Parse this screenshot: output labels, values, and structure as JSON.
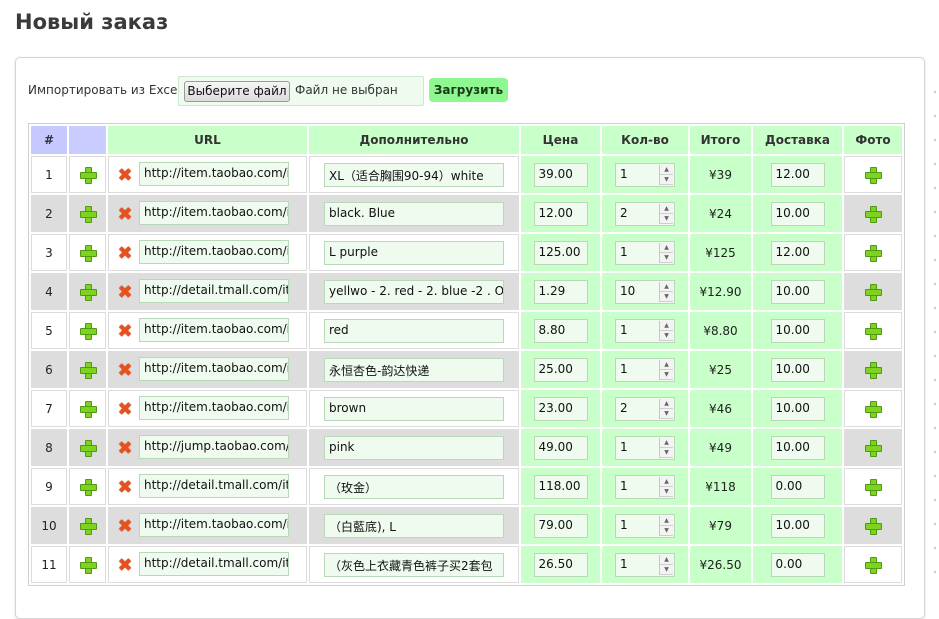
{
  "page": {
    "title": "Новый заказ"
  },
  "import": {
    "label": "Импортировать из Excel:",
    "file_button": "Выберите файл",
    "file_status": "Файл не выбран",
    "upload_button": "Загрузить"
  },
  "table": {
    "headers": {
      "num": "#",
      "url": "URL",
      "extra": "Дополнительно",
      "price": "Цена",
      "qty": "Кол-во",
      "total": "Итого",
      "shipping": "Доставка",
      "photo": "Фото"
    },
    "rows": [
      {
        "num": "1",
        "url": "http://item.taobao.com/item.htm",
        "extra": "XL（适合胸围90-94）white",
        "price": "39.00",
        "qty": "1",
        "total": "¥39",
        "shipping": "12.00"
      },
      {
        "num": "2",
        "url": "http://item.taobao.com/item.htm",
        "extra": "black. Blue",
        "price": "12.00",
        "qty": "2",
        "total": "¥24",
        "shipping": "10.00"
      },
      {
        "num": "3",
        "url": "http://item.taobao.com/item.htm",
        "extra": "L purple",
        "price": "125.00",
        "qty": "1",
        "total": "¥125",
        "shipping": "12.00"
      },
      {
        "num": "4",
        "url": "http://detail.tmall.com/item.htm",
        "extra": "yellwo - 2. red - 2. blue -2 . O",
        "price": "1.29",
        "qty": "10",
        "total": "¥12.90",
        "shipping": "10.00"
      },
      {
        "num": "5",
        "url": "http://item.taobao.com/item.htm",
        "extra": "red",
        "price": "8.80",
        "qty": "1",
        "total": "¥8.80",
        "shipping": "10.00"
      },
      {
        "num": "6",
        "url": "http://item.taobao.com/item.htm",
        "extra": "永恒杏色-韵达快递",
        "price": "25.00",
        "qty": "1",
        "total": "¥25",
        "shipping": "10.00"
      },
      {
        "num": "7",
        "url": "http://item.taobao.com/item.htm",
        "extra": "brown",
        "price": "23.00",
        "qty": "2",
        "total": "¥46",
        "shipping": "10.00"
      },
      {
        "num": "8",
        "url": "http://jump.taobao.com/jump",
        "extra": "pink",
        "price": "49.00",
        "qty": "1",
        "total": "¥49",
        "shipping": "10.00"
      },
      {
        "num": "9",
        "url": "http://detail.tmall.com/item.htm",
        "extra": "（玫金）",
        "price": "118.00",
        "qty": "1",
        "total": "¥118",
        "shipping": "0.00"
      },
      {
        "num": "10",
        "url": "http://item.taobao.com/item.htm",
        "extra": "（白藍底), L",
        "price": "79.00",
        "qty": "1",
        "total": "¥79",
        "shipping": "10.00"
      },
      {
        "num": "11",
        "url": "http://detail.tmall.com/item.htm",
        "extra": "（灰色上衣藏青色裤子买2套包",
        "price": "26.50",
        "qty": "1",
        "total": "¥26.50",
        "shipping": "0.00"
      }
    ]
  },
  "colors": {
    "header_green": "#c9ffc9",
    "header_blue": "#c5c9ff",
    "upload_button": "#8ff78f",
    "input_bg": "#eefbee",
    "delete_icon": "#e8501e",
    "plus_icon": "#7ed321",
    "row_alt": "#dddddd"
  },
  "icons": {
    "add": "plus-icon",
    "delete": "delete-icon"
  }
}
